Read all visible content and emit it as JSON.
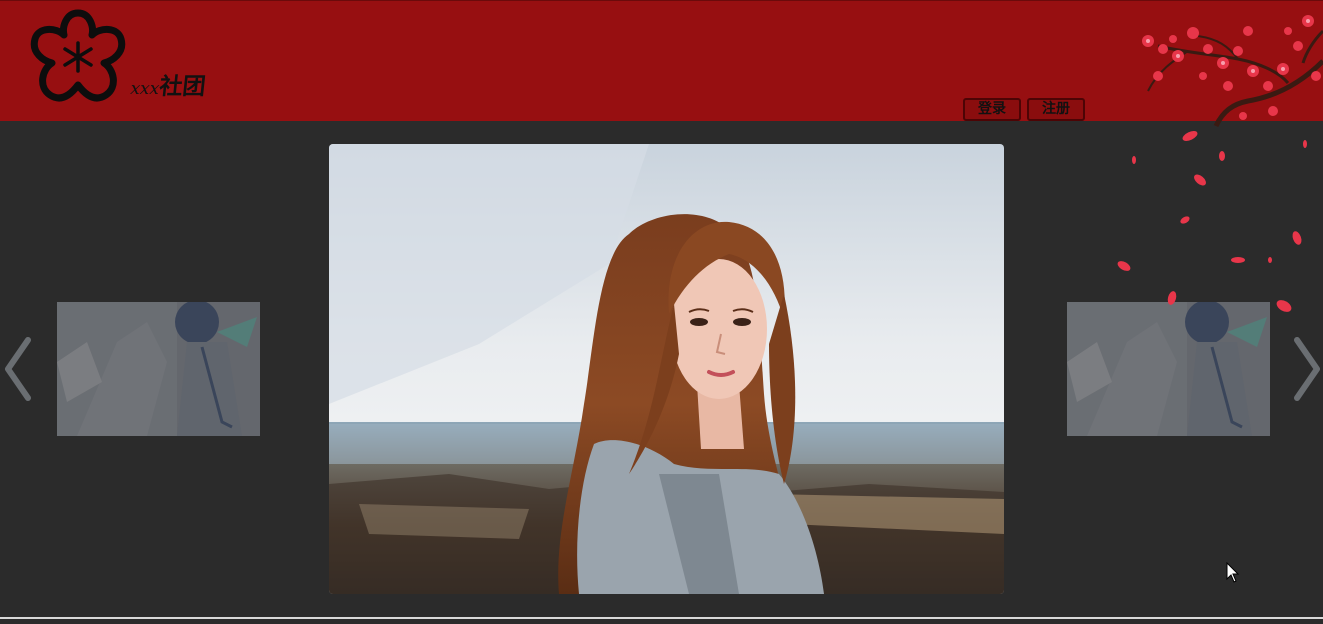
{
  "header": {
    "site_name_prefix": "xxx",
    "site_name_suffix": "社团",
    "login_label": "登录",
    "register_label": "注册",
    "background_color": "#970f11"
  },
  "carousel": {
    "slides": [
      {
        "position": "left",
        "state": "inactive"
      },
      {
        "position": "center",
        "state": "active"
      },
      {
        "position": "right",
        "state": "inactive"
      }
    ],
    "prev_icon": "chevron-left-icon",
    "next_icon": "chevron-right-icon"
  },
  "colors": {
    "page_background": "#2b2b2b",
    "accent": "#970f11"
  }
}
